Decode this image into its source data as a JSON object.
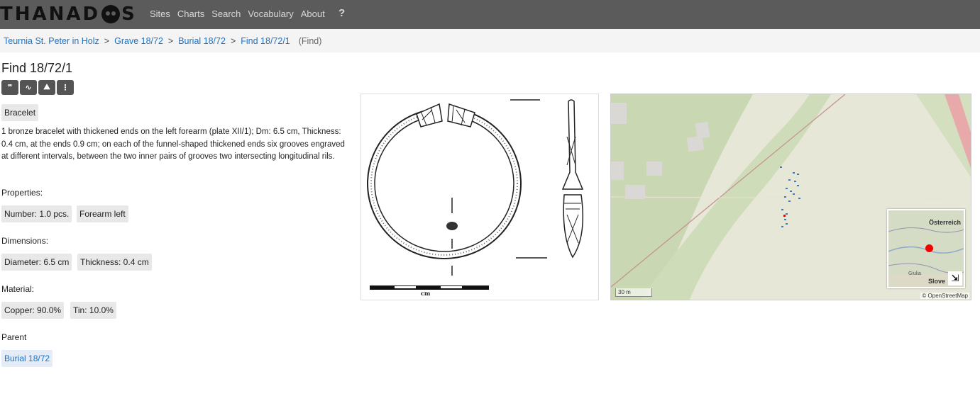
{
  "navbar": {
    "logo_left": "THANAD",
    "logo_right": "S",
    "links": [
      "Sites",
      "Charts",
      "Search",
      "Vocabulary",
      "About"
    ],
    "help": "?"
  },
  "breadcrumb": {
    "items": [
      "Teurnia St. Peter in Holz",
      "Grave 18/72",
      "Burial 18/72",
      "Find 18/72/1"
    ],
    "separator": ">",
    "type": "(Find)"
  },
  "title": "Find 18/72/1",
  "toolbar": {
    "icons": [
      "quote-icon",
      "chart-icon",
      "map-icon",
      "more-icon"
    ],
    "glyphs": [
      "❞",
      "∿",
      "⛰",
      "⋮"
    ]
  },
  "type_chip": "Bracelet",
  "description": "1 bronze bracelet with thickened ends on the left forearm (plate XII/1); Dm: 6.5 cm, Thickness: 0.4 cm, at the ends 0.9 cm; on each of the funnel-shaped thickened ends six grooves engraved at different intervals, between the two inner pairs of grooves two intersecting longitudinal rils.",
  "sections": {
    "properties": {
      "label": "Properties:",
      "items": [
        "Number: 1.0 pcs.",
        "Forearm left"
      ]
    },
    "dimensions": {
      "label": "Dimensions:",
      "items": [
        "Diameter: 6.5 cm",
        "Thickness: 0.4 cm"
      ]
    },
    "material": {
      "label": "Material:",
      "items": [
        "Copper: 90.0%",
        "Tin: 10.0%"
      ]
    },
    "parent": {
      "label": "Parent",
      "items": [
        "Burial 18/72"
      ]
    }
  },
  "drawing": {
    "scale_text": "cm"
  },
  "map": {
    "scale": "30 m",
    "attribution": "© OpenStreetMap",
    "inset_country_top": "Österreich",
    "inset_country_bottom": "Slove",
    "inset_town": "Giulia",
    "expand_glyph": "⇲",
    "colors": {
      "marker": "#f20000",
      "points": "#2a7fd4"
    }
  }
}
